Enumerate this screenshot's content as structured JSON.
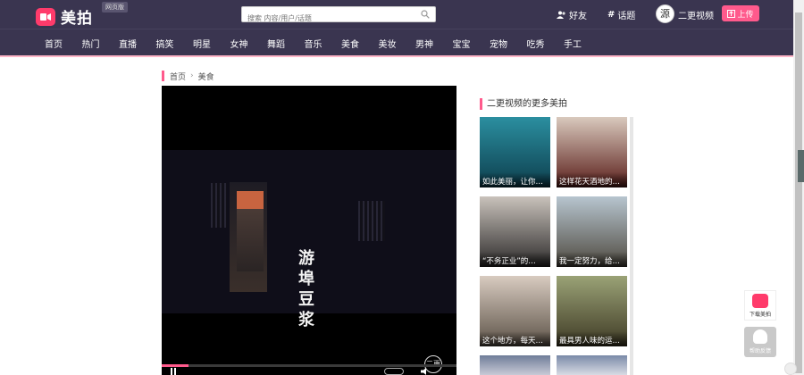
{
  "header": {
    "logo_text": "美拍",
    "web_badge": "网页版",
    "search_placeholder": "搜索 内容/用户/话题",
    "friends": "好友",
    "topics": "话题",
    "avatar_char": "源",
    "username": "二更视频",
    "upload": "上传"
  },
  "nav": {
    "items": [
      "首页",
      "热门",
      "直播",
      "搞笑",
      "明星",
      "女神",
      "舞蹈",
      "音乐",
      "美食",
      "美妆",
      "男神",
      "宝宝",
      "宠物",
      "吃秀",
      "手工"
    ]
  },
  "breadcrumb": {
    "home": "首页",
    "current": "美食"
  },
  "video": {
    "title_chars": [
      "游",
      "埠",
      "豆",
      "浆"
    ],
    "seal_text": "二更",
    "progress_percent": 9
  },
  "sidebar": {
    "title": "二更视频的更多美拍",
    "items": [
      {
        "caption": "如此美丽，让你…",
        "color_top": "#2b8fa0",
        "color_bottom": "#0d3e4d"
      },
      {
        "caption": "这样花天酒地的…",
        "color_top": "#d9c9bd",
        "color_bottom": "#5a1e1a"
      },
      {
        "caption": "“不务正业”的…",
        "color_top": "#c9c2bb",
        "color_bottom": "#2c2a2a"
      },
      {
        "caption": "我一定努力，给…",
        "color_top": "#b7c5cf",
        "color_bottom": "#4f4a40"
      },
      {
        "caption": "这个地方，每天…",
        "color_top": "#d8cbc0",
        "color_bottom": "#5c5247"
      },
      {
        "caption": "最具男人味的运…",
        "color_top": "#9aa276",
        "color_bottom": "#3f3a25"
      },
      {
        "caption": "",
        "color_top": "#6f7d99",
        "color_bottom": "#c8cad6"
      },
      {
        "caption": "",
        "color_top": "#7a8aa8",
        "color_bottom": "#d8dbe4"
      }
    ]
  },
  "widgets": {
    "download": "下载美拍",
    "feedback": "帮助反馈"
  },
  "colors": {
    "brand": "#ff3b6b",
    "accent": "#ff5a8c",
    "header_bg": "#3a3550"
  }
}
